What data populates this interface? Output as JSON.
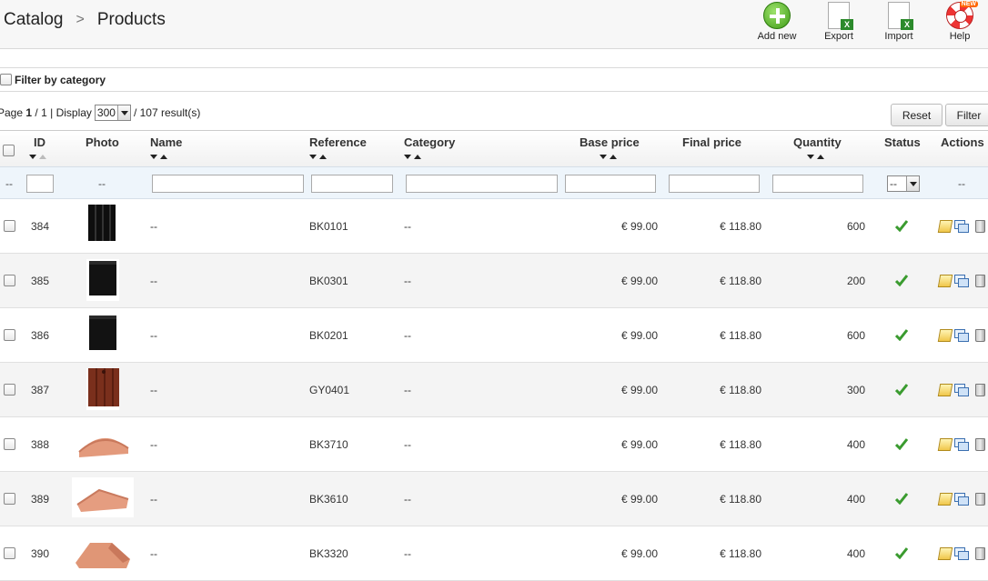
{
  "breadcrumb": {
    "parent": "Catalog",
    "separator": ">",
    "current": "Products"
  },
  "toolbar": {
    "add_label": "Add new",
    "export_label": "Export",
    "import_label": "Import",
    "help_label": "Help",
    "help_badge": "NEW"
  },
  "filter_by_category": {
    "label": "Filter by category"
  },
  "pagination": {
    "page_prefix": "Page",
    "current_page": "1",
    "sep1": "/",
    "total_pages": "1",
    "display_label": "| Display",
    "per_page": "300",
    "results": "/ 107 result(s)"
  },
  "buttons": {
    "reset": "Reset",
    "filter": "Filter"
  },
  "columns": {
    "id": "ID",
    "photo": "Photo",
    "name": "Name",
    "reference": "Reference",
    "category": "Category",
    "base_price": "Base price",
    "final_price": "Final price",
    "quantity": "Quantity",
    "status": "Status",
    "actions": "Actions"
  },
  "filter_row": {
    "placeholder_dash": "--",
    "status_value": "--"
  },
  "rows": [
    {
      "id": "384",
      "name": "--",
      "reference": "BK0101",
      "category": "--",
      "base_price": "€ 99.00",
      "final_price": "€ 118.80",
      "quantity": "600",
      "photo": "black-tall"
    },
    {
      "id": "385",
      "name": "--",
      "reference": "BK0301",
      "category": "--",
      "base_price": "€ 99.00",
      "final_price": "€ 118.80",
      "quantity": "200",
      "photo": "black-flat"
    },
    {
      "id": "386",
      "name": "--",
      "reference": "BK0201",
      "category": "--",
      "base_price": "€ 99.00",
      "final_price": "€ 118.80",
      "quantity": "600",
      "photo": "black-flat"
    },
    {
      "id": "387",
      "name": "--",
      "reference": "GY0401",
      "category": "--",
      "base_price": "€ 99.00",
      "final_price": "€ 118.80",
      "quantity": "300",
      "photo": "brown-tall"
    },
    {
      "id": "388",
      "name": "--",
      "reference": "BK3710",
      "category": "--",
      "base_price": "€ 99.00",
      "final_price": "€ 118.80",
      "quantity": "400",
      "photo": "ridge"
    },
    {
      "id": "389",
      "name": "--",
      "reference": "BK3610",
      "category": "--",
      "base_price": "€ 99.00",
      "final_price": "€ 118.80",
      "quantity": "400",
      "photo": "ridge-angled"
    },
    {
      "id": "390",
      "name": "--",
      "reference": "BK3320",
      "category": "--",
      "base_price": "€ 99.00",
      "final_price": "€ 118.80",
      "quantity": "400",
      "photo": "ridge-end"
    }
  ],
  "icons": {
    "status": "check-icon",
    "actions": [
      "edit-icon",
      "duplicate-icon",
      "delete-icon"
    ]
  },
  "colors": {
    "status_enabled": "#3a9b2f",
    "filter_row_bg": "#eef5fb",
    "alt_row_bg": "#f4f4f4"
  }
}
